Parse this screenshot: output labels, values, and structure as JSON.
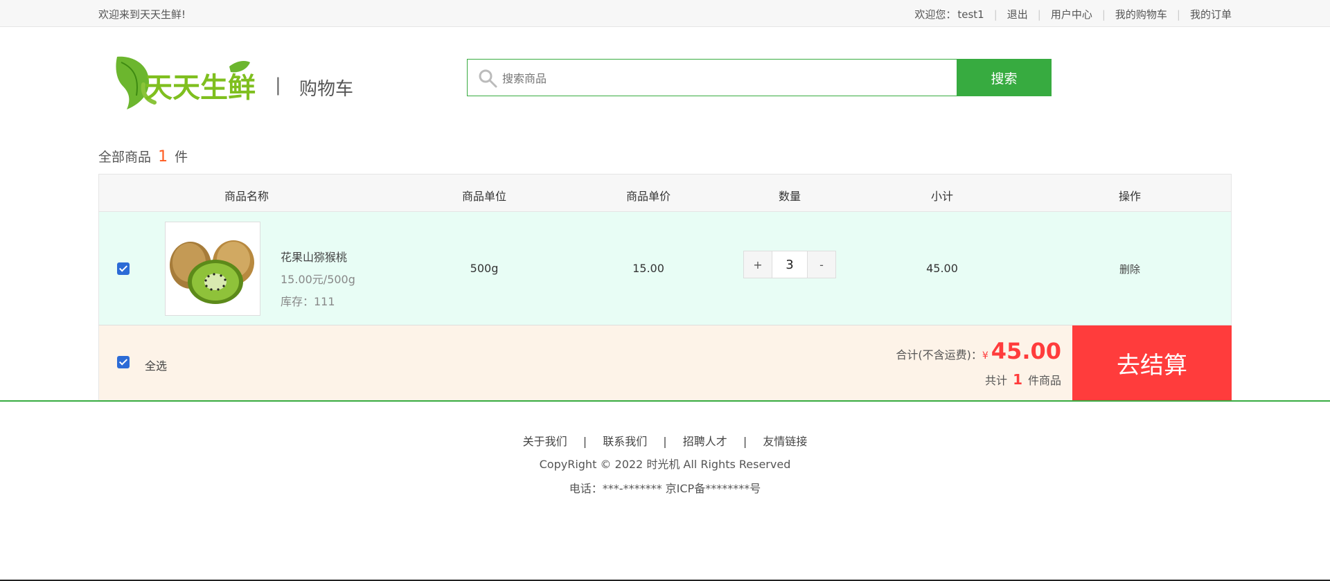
{
  "topbar": {
    "welcome": "欢迎来到天天生鲜!",
    "greeting": "欢迎您：",
    "username": "test1",
    "links": [
      "退出",
      "用户中心",
      "我的购物车",
      "我的订单"
    ]
  },
  "header": {
    "logo_text": "天天生鲜",
    "divider": "|",
    "page_name": "购物车",
    "search_placeholder": "搜索商品",
    "search_button": "搜索"
  },
  "cart": {
    "count_prefix": "全部商品",
    "count": "1",
    "count_suffix": "件",
    "columns": [
      "商品名称",
      "商品单位",
      "商品单价",
      "数量",
      "小计",
      "操作"
    ],
    "items": [
      {
        "checked": true,
        "name": "花果山猕猴桃",
        "price_unit": "15.00元/500g",
        "stock": "库存：111",
        "unit": "500g",
        "price": "15.00",
        "qty_plus": "+",
        "quantity": "3",
        "qty_minus": "-",
        "subtotal": "45.00",
        "action": "删除"
      }
    ],
    "select_all": "全选",
    "total_label": "合计(不含运费)：",
    "currency": "¥",
    "total": "45.00",
    "items_prefix": "共计",
    "items_count": "1",
    "items_suffix": "件商品",
    "checkout": "去结算"
  },
  "footer": {
    "links": [
      "关于我们",
      "联系我们",
      "招聘人才",
      "友情链接"
    ],
    "separator": "|",
    "copyright": "CopyRight © 2022 时光机 All Rights Reserved",
    "tel": "电话：***-******* 京ICP备********号"
  },
  "colors": {
    "brand_green": "#37ab40",
    "price_red": "#ff3c3c",
    "count_orange": "#ff5a1f",
    "row_bg": "#e8fdf5",
    "footer_row_bg": "#fdf3e8"
  }
}
